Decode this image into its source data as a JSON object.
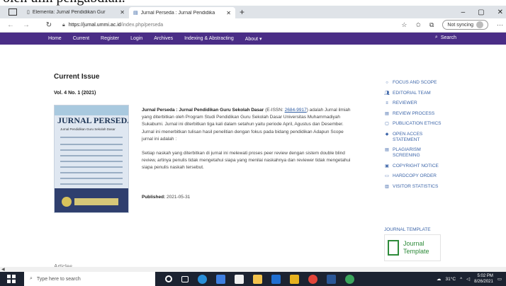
{
  "caption": "oleh ulih pengabdian.",
  "browser": {
    "tabs": [
      {
        "title": "Elementa: Jurnal Pendidikan Gur",
        "active": false
      },
      {
        "title": "Jurnal Perseda : Jurnal Pendidika",
        "active": true
      }
    ],
    "new_tab": "+",
    "window_controls": {
      "minimize": "–",
      "restore": "▢",
      "close": "✕"
    },
    "url_host": "https://jurnal.ummi.ac.id",
    "url_path": "/index.php/perseda",
    "sync_label": "Not syncing",
    "more": "···"
  },
  "site_nav": {
    "items": [
      "Home",
      "Current",
      "Register",
      "Login",
      "Archives",
      "Indexing & Abstracting",
      "About ▾"
    ],
    "search_label": "Search"
  },
  "main": {
    "heading": "Current Issue",
    "volume": "Vol. 4 No. 1 (2021)",
    "cover": {
      "title": "JURNAL PERSEDA",
      "subtitle": "Jurnal Pendidikan Guru Sekolah Dasar"
    },
    "intro_title": "Jurnal Perseda : Jurnal Pendidikan Guru Sekolah Dasar",
    "issn_prefix": "(E-ISSN:",
    "issn": "2684-9917",
    "intro_rest": ") adalah Jurnal ilmiah yang diterbitkan oleh Program Studi Pendidikan Guru Sekolah Dasar Universitas Muhammadiyah Sukabumi. Jurnal ini diterbitkan tiga kali dalam setahun yaitu periode April, Agustus dan Desember. Jurnal ini menerbitkan tulisan hasil penelitian dengan fokus pada bidang pendidikan Adapun Scope jurnal ini adalah :",
    "paragraph2": "Setiap naskah yang diterbitkan di jurnal ini melewati proses peer review dengan sistem double blind review, artinya penulis tidak mengetahui siapa yang menilai naskahnya dan reviewer tidak mengetahui siapa penulis naskah tersebut.",
    "published_label": "Published:",
    "published_date": "2021-05-31",
    "articles_label": "Articles"
  },
  "sidebar": {
    "items": [
      {
        "label": "FOCUS AND SCOPE",
        "icon": "circle-icon"
      },
      {
        "label": "EDITORIAL TEAM",
        "icon": "users-icon"
      },
      {
        "label": "REVIEWER",
        "icon": "list-icon"
      },
      {
        "label": "REVIEW PROCESS",
        "icon": "list-icon"
      },
      {
        "label": "PUBLICATION ETHICS",
        "icon": "file-icon"
      },
      {
        "label": "OPEN ACCES STATEMENT",
        "icon": "unlock-icon"
      },
      {
        "label": "PLAGIARISM SCREENING",
        "icon": "list-icon"
      },
      {
        "label": "COPYRIGHT NOTICE",
        "icon": "copyright-icon"
      },
      {
        "label": "HARDCOPY ORDER",
        "icon": "card-icon"
      },
      {
        "label": "VISITOR STATISTICS",
        "icon": "chart-icon"
      }
    ],
    "template_heading": "JOURNAL TEMPLATE",
    "template_line1": "Journal",
    "template_line2": "Template"
  },
  "taskbar": {
    "search_placeholder": "Type here to search",
    "temperature": "31°C",
    "time": "5:02 PM",
    "date": "8/26/2021"
  }
}
